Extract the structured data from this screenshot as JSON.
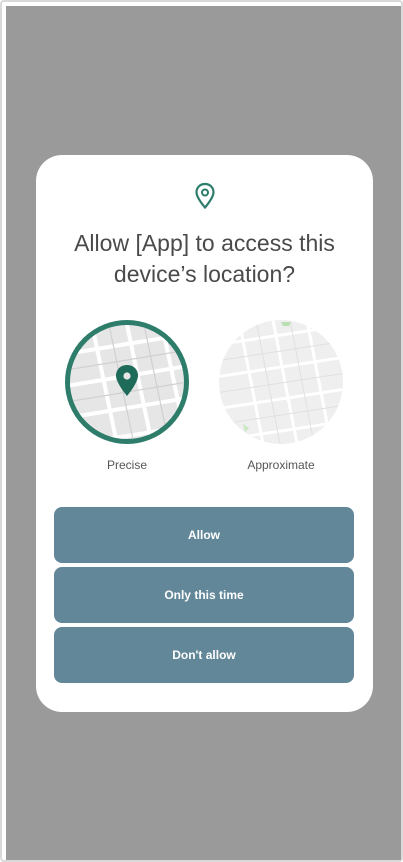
{
  "dialog": {
    "title": "Allow [App] to access this\ndevice’s location?",
    "header_icon": "location-pin-outline-icon",
    "accent_color": "#2e7d6b"
  },
  "options": {
    "precise": {
      "label": "Precise",
      "selected": true,
      "icon": "location-pin-icon"
    },
    "approximate": {
      "label": "Approximate",
      "selected": false
    }
  },
  "buttons": {
    "allow": "Allow",
    "only_this_time": "Only this time",
    "dont_allow": "Don't allow",
    "color": "#628799"
  }
}
